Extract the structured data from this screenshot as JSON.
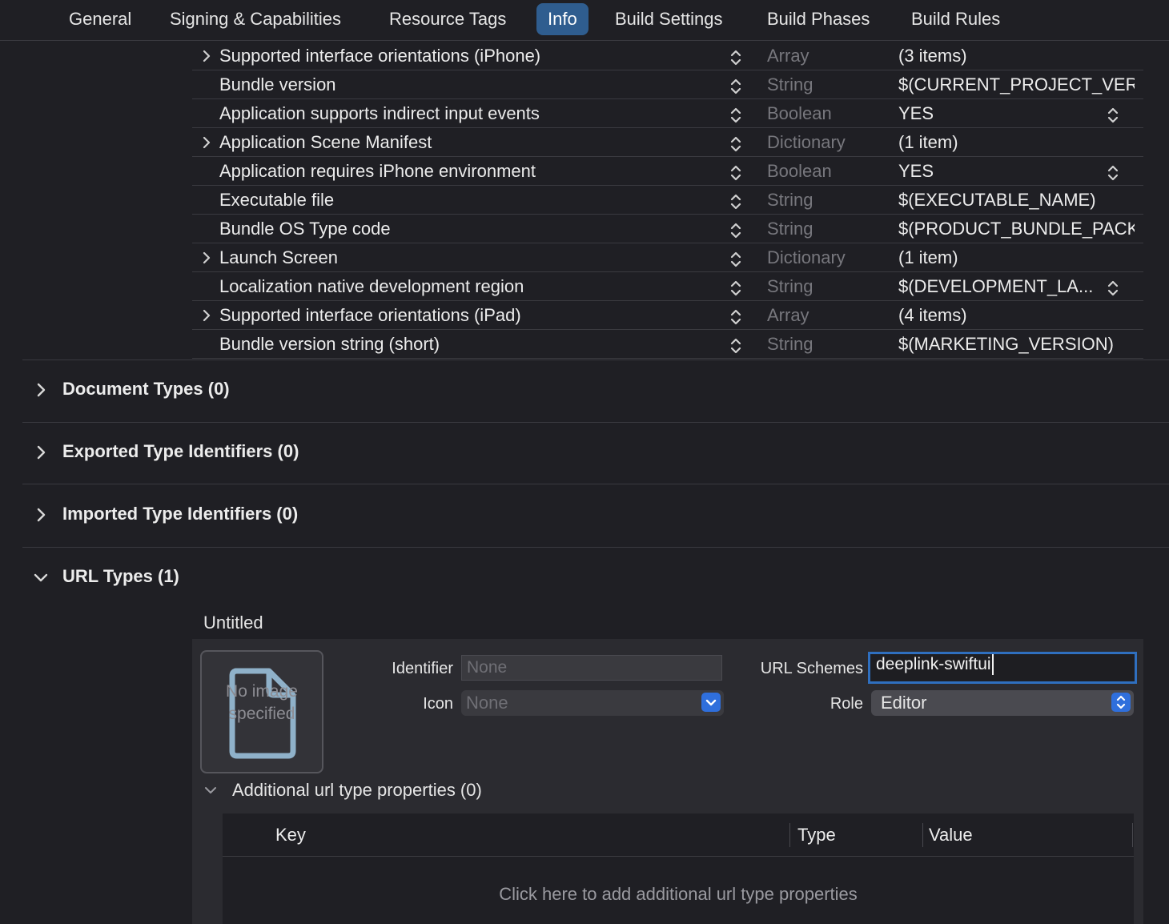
{
  "tabs": [
    {
      "label": "General",
      "active": false
    },
    {
      "label": "Signing & Capabilities",
      "active": false
    },
    {
      "label": "Resource Tags",
      "active": false
    },
    {
      "label": "Info",
      "active": true
    },
    {
      "label": "Build Settings",
      "active": false
    },
    {
      "label": "Build Phases",
      "active": false
    },
    {
      "label": "Build Rules",
      "active": false
    }
  ],
  "plist_rows": [
    {
      "key": "Supported interface orientations (iPhone)",
      "type": "Array",
      "value": "(3 items)",
      "expandable": true,
      "value_stepper": false
    },
    {
      "key": "Bundle version",
      "type": "String",
      "value": "$(CURRENT_PROJECT_VER",
      "expandable": false,
      "value_stepper": false
    },
    {
      "key": "Application supports indirect input events",
      "type": "Boolean",
      "value": "YES",
      "expandable": false,
      "value_stepper": true
    },
    {
      "key": "Application Scene Manifest",
      "type": "Dictionary",
      "value": "(1 item)",
      "expandable": true,
      "value_stepper": false
    },
    {
      "key": "Application requires iPhone environment",
      "type": "Boolean",
      "value": "YES",
      "expandable": false,
      "value_stepper": true
    },
    {
      "key": "Executable file",
      "type": "String",
      "value": "$(EXECUTABLE_NAME)",
      "expandable": false,
      "value_stepper": false
    },
    {
      "key": "Bundle OS Type code",
      "type": "String",
      "value": "$(PRODUCT_BUNDLE_PACK",
      "expandable": false,
      "value_stepper": false
    },
    {
      "key": "Launch Screen",
      "type": "Dictionary",
      "value": "(1 item)",
      "expandable": true,
      "value_stepper": false
    },
    {
      "key": "Localization native development region",
      "type": "String",
      "value": "$(DEVELOPMENT_LA...",
      "expandable": false,
      "value_stepper": true
    },
    {
      "key": "Supported interface orientations (iPad)",
      "type": "Array",
      "value": "(4 items)",
      "expandable": true,
      "value_stepper": false
    },
    {
      "key": "Bundle version string (short)",
      "type": "String",
      "value": "$(MARKETING_VERSION)",
      "expandable": false,
      "value_stepper": false
    }
  ],
  "sections": {
    "document_types": "Document Types (0)",
    "exported_types": "Exported Type Identifiers (0)",
    "imported_types": "Imported Type Identifiers (0)",
    "url_types": "URL Types (1)"
  },
  "url_type": {
    "name": "Untitled",
    "no_image_text": "No image specified",
    "identifier_label": "Identifier",
    "identifier_placeholder": "None",
    "icon_label": "Icon",
    "icon_value": "None",
    "url_schemes_label": "URL Schemes",
    "url_schemes_value": "deeplink-swiftui",
    "role_label": "Role",
    "role_value": "Editor",
    "additional_title": "Additional url type properties (0)",
    "table_headers": {
      "key": "Key",
      "type": "Type",
      "value": "Value"
    },
    "empty_hint": "Click here to add additional url type properties"
  },
  "colors": {
    "background": "#1f1f24",
    "active_tab": "#2f5d8f",
    "accent_blue": "#2f6fdc",
    "focus_ring": "#2f6fbf"
  }
}
